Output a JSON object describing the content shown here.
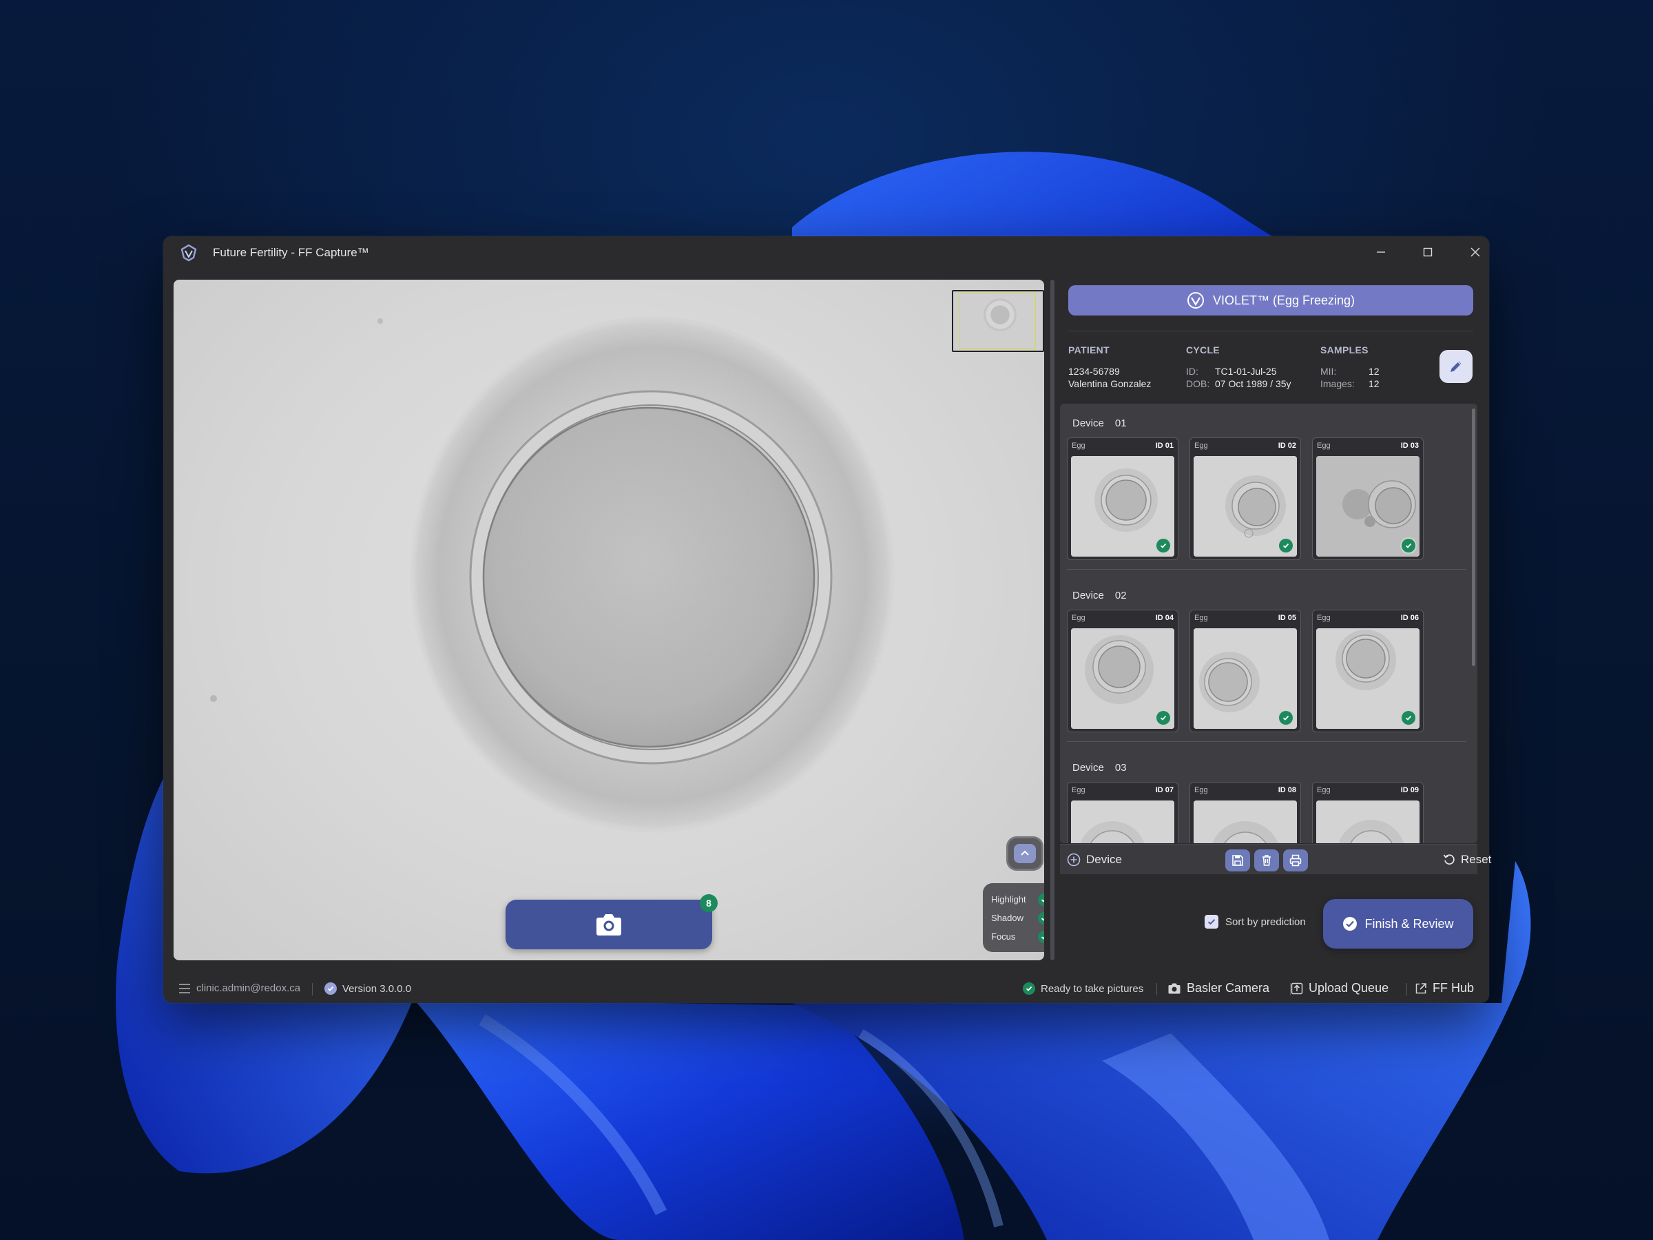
{
  "window": {
    "title": "Future Fertility - FF Capture™",
    "controls": {
      "minimize": "—",
      "maximize": "☐",
      "close": "✕"
    }
  },
  "viewer": {
    "capture_count": "8",
    "overlays": [
      {
        "label": "Highlight",
        "enabled": true
      },
      {
        "label": "Shadow",
        "enabled": true
      },
      {
        "label": "Focus",
        "enabled": true
      }
    ]
  },
  "program": {
    "label": "VIOLET™ (Egg Freezing)"
  },
  "info": {
    "patient": {
      "heading": "PATIENT",
      "id": "1234-56789",
      "name": "Valentina Gonzalez"
    },
    "cycle": {
      "heading": "CYCLE",
      "id_label": "ID:",
      "id": "TC1-01-Jul-25",
      "dob_label": "DOB:",
      "dob": "07 Oct 1989 / 35y"
    },
    "samples": {
      "heading": "SAMPLES",
      "mii_label": "MII:",
      "mii": "12",
      "images_label": "Images:",
      "images": "12"
    }
  },
  "devices": [
    {
      "label": "Device",
      "number": "01",
      "eggs": [
        {
          "kind": "Egg",
          "id": "ID 01",
          "checked": true
        },
        {
          "kind": "Egg",
          "id": "ID 02",
          "checked": true
        },
        {
          "kind": "Egg",
          "id": "ID 03",
          "checked": true
        }
      ]
    },
    {
      "label": "Device",
      "number": "02",
      "eggs": [
        {
          "kind": "Egg",
          "id": "ID 04",
          "checked": true
        },
        {
          "kind": "Egg",
          "id": "ID 05",
          "checked": true
        },
        {
          "kind": "Egg",
          "id": "ID 06",
          "checked": true
        }
      ]
    },
    {
      "label": "Device",
      "number": "03",
      "eggs": [
        {
          "kind": "Egg",
          "id": "ID 07",
          "checked": false
        },
        {
          "kind": "Egg",
          "id": "ID 08",
          "checked": false
        },
        {
          "kind": "Egg",
          "id": "ID 09",
          "checked": false
        }
      ]
    }
  ],
  "toolbar": {
    "add_device": "Device",
    "reset": "Reset"
  },
  "actions": {
    "sort_label": "Sort by prediction",
    "sort_checked": true,
    "finish": "Finish & Review"
  },
  "status": {
    "user": "clinic.admin@redox.ca",
    "version": "Version 3.0.0.0",
    "ready": "Ready to take pictures",
    "camera": "Basler Camera",
    "upload": "Upload Queue",
    "hub": "FF Hub"
  },
  "colors": {
    "accent": "#7379c4",
    "primary_button": "#42539a",
    "success": "#1c8a5c",
    "window_bg": "#2b2b2e"
  }
}
